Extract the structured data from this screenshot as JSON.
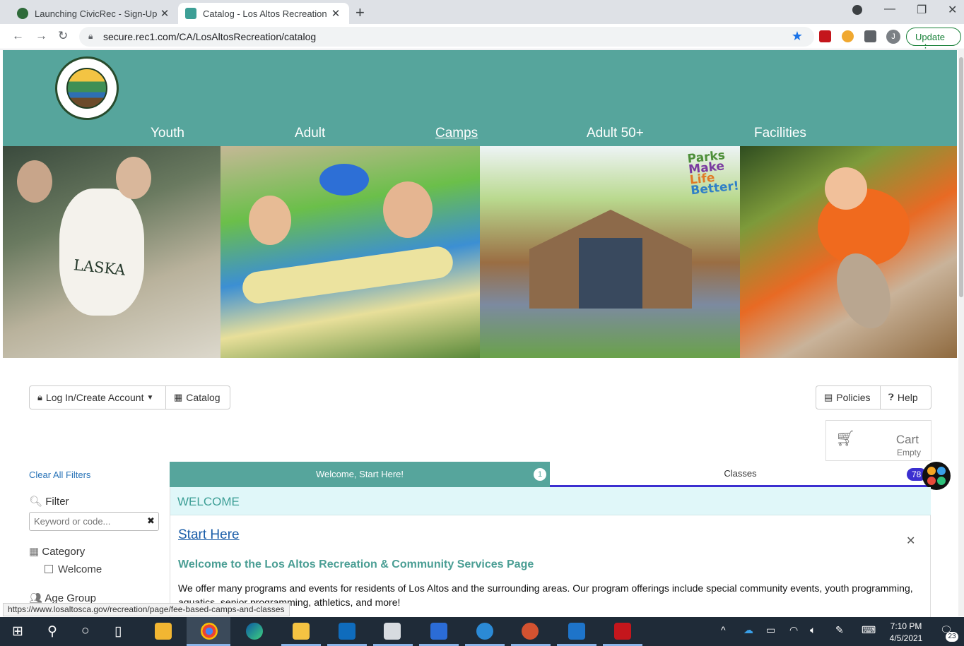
{
  "browser": {
    "tabs": [
      {
        "title": "Launching CivicRec - Sign-Up for",
        "active": false
      },
      {
        "title": "Catalog - Los Altos Recreation",
        "active": true
      }
    ],
    "url": "secure.rec1.com/CA/LosAltosRecreation/catalog",
    "profile_initial": "J",
    "update_label": "Update",
    "status_url": "https://www.losaltosca.gov/recreation/page/fee-based-camps-and-classes"
  },
  "site": {
    "nav": [
      "Youth",
      "Adult",
      "Camps",
      "Adult 50+",
      "Facilities"
    ],
    "current_nav": "Camps",
    "hero_overlay": [
      "Parks",
      "Make",
      "Life",
      "Better!"
    ],
    "hero_shirt_text": "LASKA"
  },
  "toolbar": {
    "login_label": "Log In/Create Account",
    "catalog_label": "Catalog",
    "policies_label": "Policies",
    "help_label": "Help"
  },
  "cart": {
    "label": "Cart",
    "status": "Empty"
  },
  "sidebar": {
    "clear_filters": "Clear All Filters",
    "filter_heading": "Filter",
    "keyword_placeholder": "Keyword or code...",
    "category_heading": "Category",
    "category_options": [
      "Welcome"
    ],
    "age_heading": "Age Group"
  },
  "tabs": [
    {
      "label": "Welcome, Start Here!",
      "count": "1"
    },
    {
      "label": "Classes",
      "count": "78"
    }
  ],
  "content": {
    "section_heading": "WELCOME",
    "start_link": "Start Here",
    "title": "Welcome to the Los Altos Recreation & Community Services Page",
    "intro": "We offer many programs and events for residents of Los Altos and the surrounding areas. Our program offerings include special community events, youth programming, aquatics, senior programming, athletics, and more!"
  },
  "taskbar": {
    "time": "7:10 PM",
    "date": "4/5/2021",
    "notifications": "23"
  },
  "colors": {
    "header": "#56a59c",
    "accent": "#3b2fd0",
    "link": "#2a74b8"
  }
}
